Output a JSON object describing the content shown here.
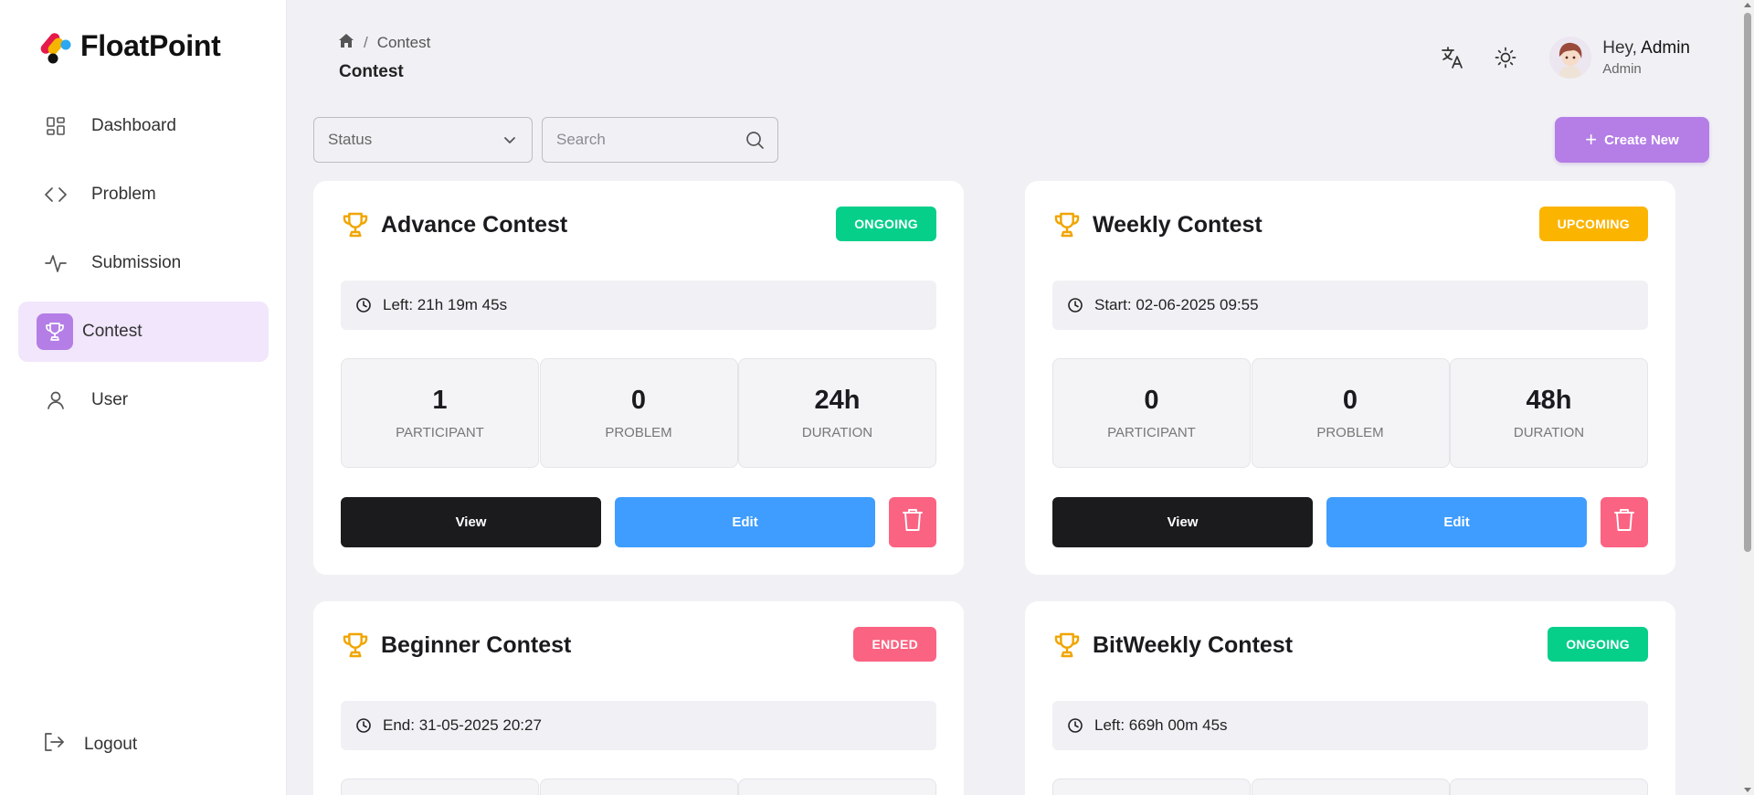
{
  "app": {
    "name": "FloatPoint"
  },
  "sidebar": {
    "items": [
      {
        "label": "Dashboard",
        "icon": "dashboard-icon"
      },
      {
        "label": "Problem",
        "icon": "code-icon"
      },
      {
        "label": "Submission",
        "icon": "activity-icon"
      },
      {
        "label": "Contest",
        "icon": "trophy-icon",
        "active": true
      },
      {
        "label": "User",
        "icon": "user-icon"
      }
    ],
    "logout_label": "Logout"
  },
  "header": {
    "breadcrumb": {
      "current": "Contest",
      "home_icon": "home-icon"
    },
    "title": "Contest",
    "user": {
      "greeting": "Hey,",
      "name": "Admin",
      "role": "Admin"
    }
  },
  "toolbar": {
    "status_label": "Status",
    "search_placeholder": "Search",
    "create_label": "Create New"
  },
  "contests": [
    {
      "title": "Advance Contest",
      "status": "ONGOING",
      "status_color": "#06cf8a",
      "time_text": "Left: 21h 19m 45s",
      "stats": [
        {
          "value": "1",
          "label": "PARTICIPANT"
        },
        {
          "value": "0",
          "label": "PROBLEM"
        },
        {
          "value": "24h",
          "label": "DURATION"
        }
      ],
      "view_label": "View",
      "edit_label": "Edit"
    },
    {
      "title": "Weekly Contest",
      "status": "UPCOMING",
      "status_color": "#fbb400",
      "time_text": "Start: 02-06-2025 09:55",
      "stats": [
        {
          "value": "0",
          "label": "PARTICIPANT"
        },
        {
          "value": "0",
          "label": "PROBLEM"
        },
        {
          "value": "48h",
          "label": "DURATION"
        }
      ],
      "view_label": "View",
      "edit_label": "Edit"
    },
    {
      "title": "Beginner Contest",
      "status": "ENDED",
      "status_color": "#fb6382",
      "time_text": "End: 31-05-2025 20:27"
    },
    {
      "title": "BitWeekly Contest",
      "status": "ONGOING",
      "status_color": "#06cf8a",
      "time_text": "Left: 669h 00m 45s"
    }
  ],
  "colors": {
    "accent": "#b47ee6",
    "active_bg": "#f1e6fb",
    "view_button": "#1b1b1d",
    "edit_button": "#3f9dff",
    "delete_button": "#fb6382",
    "trophy": "#f0a500"
  }
}
